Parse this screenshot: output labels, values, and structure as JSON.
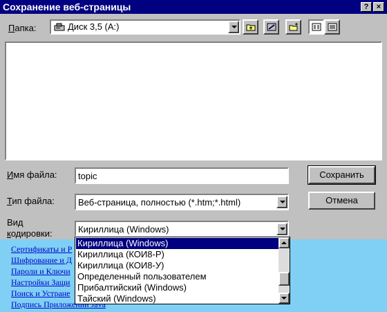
{
  "dialog": {
    "title": "Сохранение веб-страницы",
    "help_button": "?",
    "close_button": "×"
  },
  "folder": {
    "label_prefix": "П",
    "label_rest": "апка:",
    "value": "Диск 3,5 (A:)",
    "icon": "floppy-drive-icon"
  },
  "toolbar": {
    "icons": [
      "up-folder-icon",
      "desktop-icon",
      "new-folder-icon",
      "list-view-icon",
      "details-view-icon"
    ]
  },
  "filename": {
    "label_prefix": "И",
    "label_rest": "мя файла:",
    "value": "topic"
  },
  "filetype": {
    "label_prefix": "Т",
    "label_rest": "ип файла:",
    "value": "Веб-страница, полностью (*.htm;*.html)"
  },
  "encoding": {
    "label_line1": "Вид",
    "label_line2_prefix": "к",
    "label_line2_rest": "одировки:",
    "value": "Кириллица (Windows)",
    "options": [
      {
        "label": "Кириллица (Windows)",
        "selected": true
      },
      {
        "label": "Кириллица (КОИ8-Р)",
        "selected": false
      },
      {
        "label": "Кириллица (КОИ8-У)",
        "selected": false
      },
      {
        "label": "Определенный пользователем",
        "selected": false
      },
      {
        "label": "Прибалтийский (Windows)",
        "selected": false
      },
      {
        "label": "Тайский (Windows)",
        "selected": false
      }
    ]
  },
  "buttons": {
    "save": "Сохранить",
    "cancel": "Отмена"
  },
  "background_links": [
    "Сертификаты и Р",
    "Шифрование и Д",
    "Пароли и Ключи",
    "Настройки Защи",
    "Поиск и Устране",
    "Подпись Приложений Java"
  ],
  "colors": {
    "titlebar": "#000080",
    "selection": "#000080",
    "dialog_face": "#c0c0c0",
    "page_background": "#7fd0f4",
    "link": "#0000cc"
  }
}
